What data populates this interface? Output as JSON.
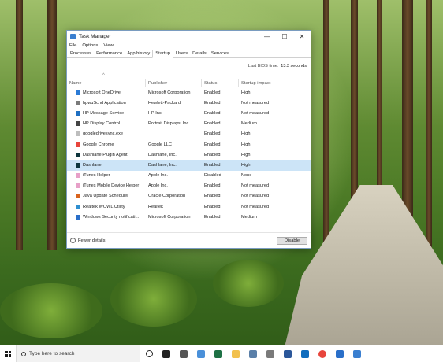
{
  "window": {
    "title": "Task Manager",
    "controls": {
      "minimize": "—",
      "maximize": "☐",
      "close": "✕"
    }
  },
  "menu": [
    "File",
    "Options",
    "View"
  ],
  "tabs": [
    "Processes",
    "Performance",
    "App history",
    "Startup",
    "Users",
    "Details",
    "Services"
  ],
  "active_tab": "Startup",
  "bios": {
    "label": "Last BIOS time:",
    "value": "13.3 seconds"
  },
  "columns": [
    "Name",
    "Publisher",
    "Status",
    "Startup impact"
  ],
  "rows": [
    {
      "name": "Microsoft OneDrive",
      "publisher": "Microsoft Corporation",
      "status": "Enabled",
      "impact": "High",
      "icon": "onedrive-icon",
      "color": "#2b7bd6"
    },
    {
      "name": "hpwuSchd Application",
      "publisher": "Hewlett-Packard",
      "status": "Enabled",
      "impact": "Not measured",
      "icon": "app-icon",
      "color": "#7a7a7a"
    },
    {
      "name": "HP Message Service",
      "publisher": "HP Inc.",
      "status": "Enabled",
      "impact": "Not measured",
      "icon": "hp-icon",
      "color": "#1f6fc2"
    },
    {
      "name": "HP Display Control",
      "publisher": "Portrait Displays, Inc.",
      "status": "Enabled",
      "impact": "Medium",
      "icon": "display-icon",
      "color": "#444444"
    },
    {
      "name": "googledrivesync.exe",
      "publisher": "",
      "status": "Enabled",
      "impact": "High",
      "icon": "file-icon",
      "color": "#bdbdbd"
    },
    {
      "name": "Google Chrome",
      "publisher": "Google LLC",
      "status": "Enabled",
      "impact": "High",
      "icon": "chrome-icon",
      "color": "#e8453c"
    },
    {
      "name": "Dashlane Plugin Agent",
      "publisher": "Dashlane, Inc.",
      "status": "Enabled",
      "impact": "High",
      "icon": "dashlane-icon",
      "color": "#0e353d"
    },
    {
      "name": "Dashlane",
      "publisher": "Dashlane, Inc.",
      "status": "Enabled",
      "impact": "High",
      "icon": "dashlane-icon",
      "color": "#0e353d",
      "selected": true
    },
    {
      "name": "iTunes Helper",
      "publisher": "Apple Inc.",
      "status": "Disabled",
      "impact": "None",
      "icon": "itunes-icon",
      "color": "#e7a0c8"
    },
    {
      "name": "iTunes Mobile Device Helper",
      "publisher": "Apple Inc.",
      "status": "Enabled",
      "impact": "Not measured",
      "icon": "itunes-icon",
      "color": "#e7a0c8"
    },
    {
      "name": "Java Update Scheduler",
      "publisher": "Oracle Corporation",
      "status": "Enabled",
      "impact": "Not measured",
      "icon": "java-icon",
      "color": "#d9641e"
    },
    {
      "name": "Realtek WOWL Utility",
      "publisher": "Realtek",
      "status": "Enabled",
      "impact": "Not measured",
      "icon": "realtek-icon",
      "color": "#2f8fd0"
    },
    {
      "name": "Windows Security notificati...",
      "publisher": "Microsoft Corporation",
      "status": "Enabled",
      "impact": "Medium",
      "icon": "shield-icon",
      "color": "#2a6fc9"
    }
  ],
  "footer": {
    "fewer_details": "Fewer details",
    "disable_button": "Disable"
  },
  "taskbar": {
    "search_placeholder": "Type here to search",
    "icons": [
      {
        "name": "cortana-icon",
        "color": "#222222"
      },
      {
        "name": "task-view-icon",
        "color": "#222222"
      },
      {
        "name": "app-4-icon",
        "color": "#555555"
      },
      {
        "name": "app-icon",
        "color": "#4a90d9"
      },
      {
        "name": "excel-icon",
        "color": "#1e7145"
      },
      {
        "name": "file-explorer-icon",
        "color": "#f2c14e"
      },
      {
        "name": "photos-icon",
        "color": "#5a7fa8"
      },
      {
        "name": "app-icon",
        "color": "#7a7a7a"
      },
      {
        "name": "word-icon",
        "color": "#2b579a"
      },
      {
        "name": "outlook-icon",
        "color": "#0f6cbd"
      },
      {
        "name": "chrome-icon",
        "color": "#e8453c"
      },
      {
        "name": "security-icon",
        "color": "#2a6fc9"
      },
      {
        "name": "app-icon",
        "color": "#3a7fd0"
      }
    ]
  }
}
